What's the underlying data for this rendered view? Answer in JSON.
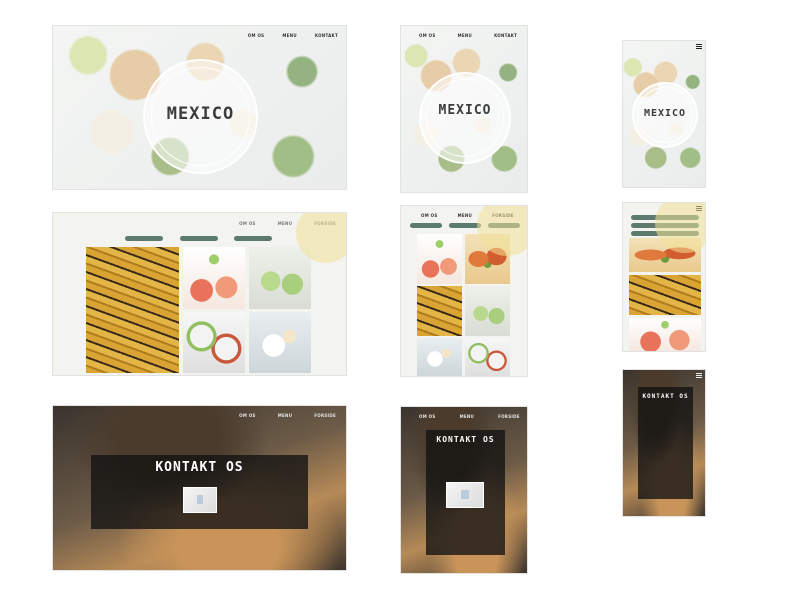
{
  "nav": {
    "about": "OM OS",
    "menu": "MENU",
    "contact": "KONTAKT",
    "home": "FORSIDE"
  },
  "hero": {
    "logo": "MEXICO"
  },
  "contact": {
    "title": "KONTAKT OS"
  },
  "colors": {
    "accent": "#5c7a6e",
    "overlay": "#121212",
    "highlight": "#b32020"
  },
  "icons": {
    "menu": "hamburger-icon",
    "map": "map-thumbnail"
  }
}
